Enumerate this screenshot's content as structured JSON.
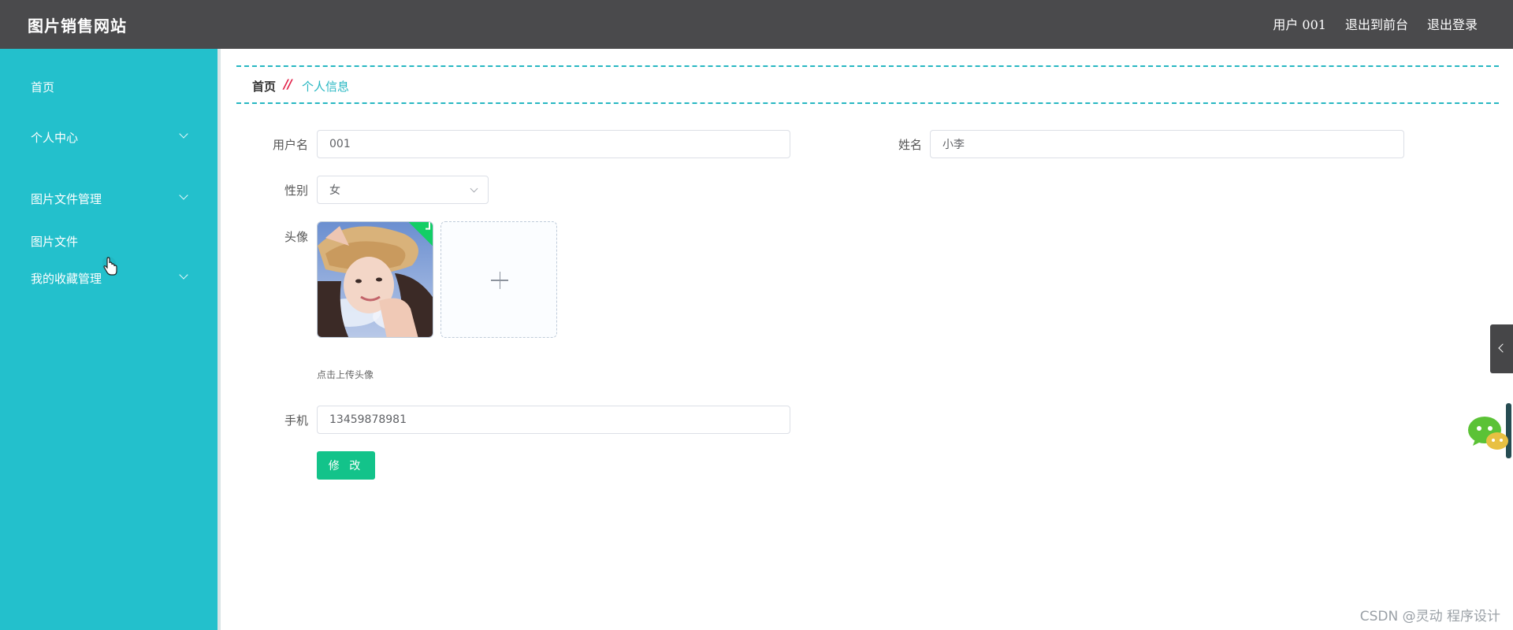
{
  "header": {
    "brand": "图片销售网站",
    "user_label": "用户 001",
    "to_frontend": "退出到前台",
    "logout": "退出登录"
  },
  "sidebar": {
    "items": [
      {
        "label": "首页",
        "has_submenu": false
      },
      {
        "label": "个人中心",
        "has_submenu": true
      },
      {
        "label": "图片文件管理",
        "has_submenu": true
      },
      {
        "label": "图片文件",
        "has_submenu": false
      },
      {
        "label": "我的收藏管理",
        "has_submenu": true
      }
    ]
  },
  "breadcrumb": {
    "home": "首页",
    "separator": "//",
    "current": "个人信息"
  },
  "form": {
    "username_label": "用户名",
    "username_value": "001",
    "name_label": "姓名",
    "name_value": "小李",
    "gender_label": "性别",
    "gender_value": "女",
    "avatar_label": "头像",
    "avatar_hint": "点击上传头像",
    "phone_label": "手机",
    "phone_value": "13459878981",
    "submit_label": "修 改"
  },
  "watermark": "CSDN @灵动 程序设计",
  "colors": {
    "topbar": "#4a4a4c",
    "sidebar": "#23c0cc",
    "accent": "#27b7c2",
    "breadcrumb_sep": "#e2224a",
    "button": "#13c38a",
    "success_badge": "#13ce66"
  },
  "icons": {
    "sidebar_chevron": "chevron-down-icon",
    "avatar_check": "check-icon",
    "upload": "plus-icon",
    "side_tab": "chevron-left-icon",
    "chat": "wechat-icon"
  }
}
